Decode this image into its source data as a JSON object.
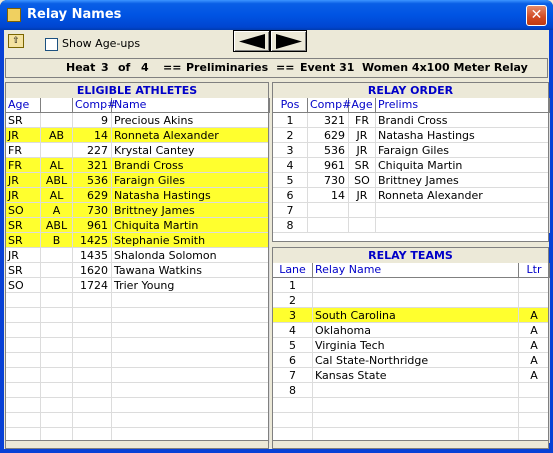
{
  "window": {
    "title": "Relay Names",
    "close_label": "✕"
  },
  "toolbar": {
    "show_ageups_label": "Show Age-ups",
    "show_ageups_checked": false
  },
  "heat": {
    "heat_label": "Heat",
    "heat_num": "3",
    "of_label": "of",
    "heat_total": "4",
    "sep1": "==",
    "round": "Preliminaries",
    "sep2": "==",
    "event": "Event 31  Women 4x100 Meter Relay"
  },
  "eligible": {
    "title": "ELIGIBLE ATHLETES",
    "columns": [
      "Age",
      "",
      "Comp#",
      "Name"
    ],
    "rows": [
      {
        "age": "SR",
        "code": "",
        "comp": "9",
        "name": "Precious Akins",
        "hl": false
      },
      {
        "age": "JR",
        "code": "AB",
        "comp": "14",
        "name": "Ronneta Alexander",
        "hl": true
      },
      {
        "age": "FR",
        "code": "",
        "comp": "227",
        "name": "Krystal Cantey",
        "hl": false
      },
      {
        "age": "FR",
        "code": "AL",
        "comp": "321",
        "name": "Brandi Cross",
        "hl": true
      },
      {
        "age": "JR",
        "code": "ABL",
        "comp": "536",
        "name": "Faraign Giles",
        "hl": true
      },
      {
        "age": "JR",
        "code": "AL",
        "comp": "629",
        "name": "Natasha Hastings",
        "hl": true
      },
      {
        "age": "SO",
        "code": "A",
        "comp": "730",
        "name": "Brittney James",
        "hl": true
      },
      {
        "age": "SR",
        "code": "ABL",
        "comp": "961",
        "name": "Chiquita Martin",
        "hl": true
      },
      {
        "age": "SR",
        "code": "B",
        "comp": "1425",
        "name": "Stephanie Smith",
        "hl": true
      },
      {
        "age": "JR",
        "code": "",
        "comp": "1435",
        "name": "Shalonda Solomon",
        "hl": false
      },
      {
        "age": "SR",
        "code": "",
        "comp": "1620",
        "name": "Tawana Watkins",
        "hl": false
      },
      {
        "age": "SO",
        "code": "",
        "comp": "1724",
        "name": "Trier Young",
        "hl": false
      }
    ],
    "blank_rows": 10
  },
  "order": {
    "title": "RELAY ORDER",
    "columns": [
      "Pos",
      "Comp#",
      "Age",
      "Prelims"
    ],
    "rows": [
      {
        "pos": "1",
        "comp": "321",
        "age": "FR",
        "name": "Brandi Cross"
      },
      {
        "pos": "2",
        "comp": "629",
        "age": "JR",
        "name": "Natasha Hastings"
      },
      {
        "pos": "3",
        "comp": "536",
        "age": "JR",
        "name": "Faraign Giles"
      },
      {
        "pos": "4",
        "comp": "961",
        "age": "SR",
        "name": "Chiquita Martin"
      },
      {
        "pos": "5",
        "comp": "730",
        "age": "SO",
        "name": "Brittney James"
      },
      {
        "pos": "6",
        "comp": "14",
        "age": "JR",
        "name": "Ronneta Alexander"
      },
      {
        "pos": "7",
        "comp": "",
        "age": "",
        "name": ""
      },
      {
        "pos": "8",
        "comp": "",
        "age": "",
        "name": ""
      }
    ]
  },
  "teams": {
    "title": "RELAY TEAMS",
    "columns": [
      "Lane",
      "Relay Name",
      "Ltr"
    ],
    "rows": [
      {
        "lane": "1",
        "name": "",
        "ltr": "",
        "hl": false
      },
      {
        "lane": "2",
        "name": "",
        "ltr": "",
        "hl": false
      },
      {
        "lane": "3",
        "name": "South Carolina",
        "ltr": "A",
        "hl": true
      },
      {
        "lane": "4",
        "name": "Oklahoma",
        "ltr": "A",
        "hl": false
      },
      {
        "lane": "5",
        "name": "Virginia Tech",
        "ltr": "A",
        "hl": false
      },
      {
        "lane": "6",
        "name": "Cal State-Northridge",
        "ltr": "A",
        "hl": false
      },
      {
        "lane": "7",
        "name": "Kansas State",
        "ltr": "A",
        "hl": false
      },
      {
        "lane": "8",
        "name": "",
        "ltr": "",
        "hl": false
      }
    ],
    "blank_rows": 3
  },
  "colors": {
    "highlight": "#ffff2e",
    "header_text": "#0000c8",
    "title_bar": "#0054e3"
  },
  "icons": {
    "title": "app-icon",
    "toolbar": "folder-up-icon",
    "prev": "left-arrow-icon",
    "next": "right-arrow-icon",
    "close": "close-icon"
  }
}
